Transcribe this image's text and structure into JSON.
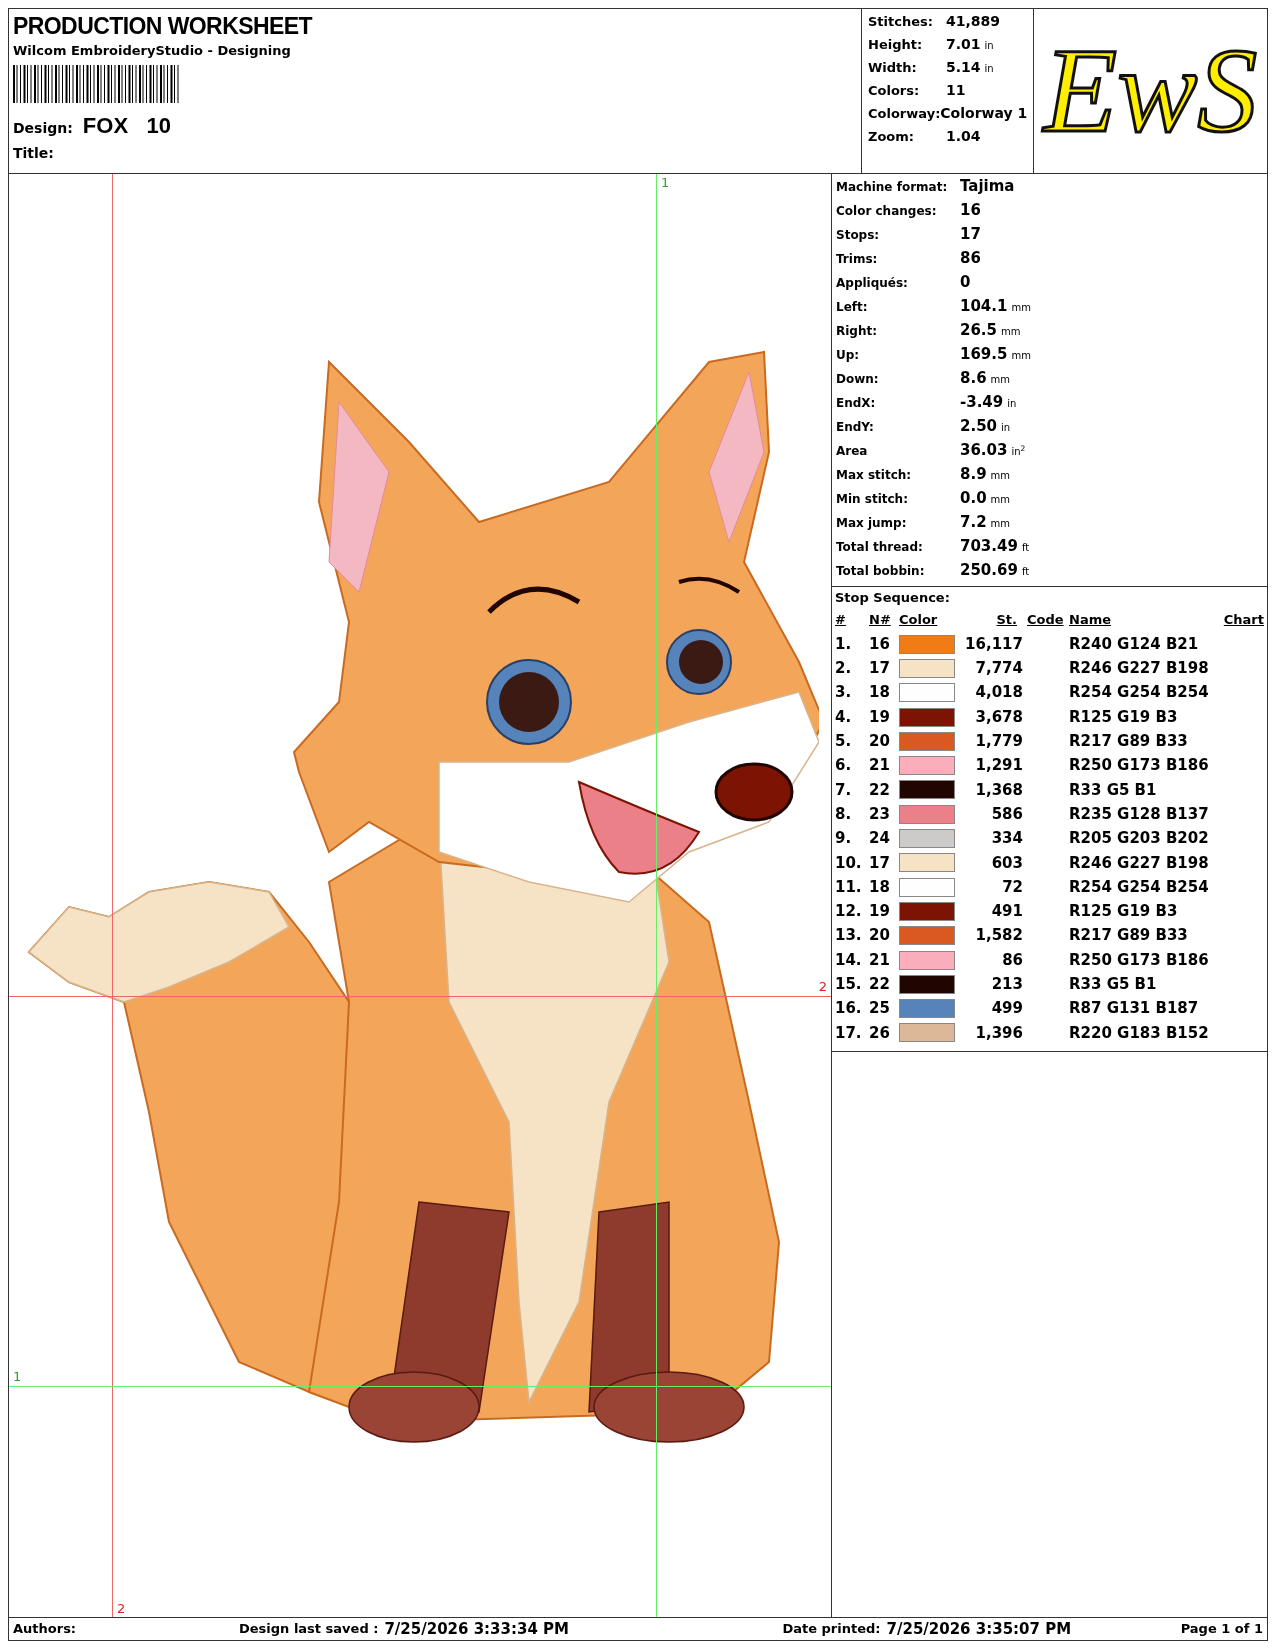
{
  "header": {
    "title": "PRODUCTION WORKSHEET",
    "subtitle": "Wilcom EmbroideryStudio - Designing",
    "design_label": "Design:",
    "design_value": "FOX   10",
    "title_label": "Title:"
  },
  "summary": [
    {
      "label": "Stitches:",
      "value": "41,889"
    },
    {
      "label": "Height:",
      "value": "7.01",
      "unit": "in"
    },
    {
      "label": "Width:",
      "value": "5.14",
      "unit": "in"
    },
    {
      "label": "Colors:",
      "value": "11"
    },
    {
      "label": "Colorway:",
      "value": "Colorway 1"
    },
    {
      "label": "Zoom:",
      "value": "1.04"
    }
  ],
  "logo": {
    "text": "EwS"
  },
  "guides": [
    {
      "kind": "vertical",
      "label": "1",
      "color": "#66ee66"
    },
    {
      "kind": "vertical",
      "label": "2",
      "color": "#ee6666"
    },
    {
      "kind": "horizontal",
      "label": "2",
      "color": "#ee6666"
    },
    {
      "kind": "horizontal",
      "label": "1",
      "color": "#66ee66"
    }
  ],
  "details": [
    {
      "label": "Machine format:",
      "value": "Tajima"
    },
    {
      "label": "Color changes:",
      "value": "16"
    },
    {
      "label": "Stops:",
      "value": "17"
    },
    {
      "label": "Trims:",
      "value": "86"
    },
    {
      "label": "Appliqués:",
      "value": "0"
    },
    {
      "label": "Left:",
      "value": "104.1",
      "unit": "mm"
    },
    {
      "label": "Right:",
      "value": "26.5",
      "unit": "mm"
    },
    {
      "label": "Up:",
      "value": "169.5",
      "unit": "mm"
    },
    {
      "label": "Down:",
      "value": "8.6",
      "unit": "mm"
    },
    {
      "label": "EndX:",
      "value": "-3.49",
      "unit": "in"
    },
    {
      "label": "EndY:",
      "value": "2.50",
      "unit": "in"
    },
    {
      "label": "Area",
      "value": "36.03",
      "unit": "in$^{2}$"
    },
    {
      "label": "Max stitch:",
      "value": "8.9",
      "unit": "mm"
    },
    {
      "label": "Min stitch:",
      "value": "0.0",
      "unit": "mm"
    },
    {
      "label": "Max jump:",
      "value": "7.2",
      "unit": "mm"
    },
    {
      "label": "Total thread:",
      "value": "703.49",
      "unit": "ft"
    },
    {
      "label": "Total bobbin:",
      "value": "250.69",
      "unit": "ft"
    }
  ],
  "stop_sequence": {
    "title": "Stop Sequence:",
    "columns": [
      "#",
      "N#",
      "Color",
      "St.",
      "Code",
      "Name",
      "Chart"
    ],
    "rows": [
      {
        "index": "1.",
        "n": "16",
        "color": "#f07c15",
        "stitches": "16,117",
        "name": "R240 G124 B21"
      },
      {
        "index": "2.",
        "n": "17",
        "color": "#f6e3c6",
        "stitches": "7,774",
        "name": "R246 G227 B198"
      },
      {
        "index": "3.",
        "n": "18",
        "color": "#fefefe",
        "stitches": "4,018",
        "name": "R254 G254 B254"
      },
      {
        "index": "4.",
        "n": "19",
        "color": "#7d1303",
        "stitches": "3,678",
        "name": "R125 G19 B3"
      },
      {
        "index": "5.",
        "n": "20",
        "color": "#d95921",
        "stitches": "1,779",
        "name": "R217 G89 B33"
      },
      {
        "index": "6.",
        "n": "21",
        "color": "#faadba",
        "stitches": "1,291",
        "name": "R250 G173 B186"
      },
      {
        "index": "7.",
        "n": "22",
        "color": "#210501",
        "stitches": "1,368",
        "name": "R33 G5 B1"
      },
      {
        "index": "8.",
        "n": "23",
        "color": "#eb8089",
        "stitches": "586",
        "name": "R235 G128 B137"
      },
      {
        "index": "9.",
        "n": "24",
        "color": "#cdcbca",
        "stitches": "334",
        "name": "R205 G203 B202"
      },
      {
        "index": "10.",
        "n": "17",
        "color": "#f6e3c6",
        "stitches": "603",
        "name": "R246 G227 B198"
      },
      {
        "index": "11.",
        "n": "18",
        "color": "#fefefe",
        "stitches": "72",
        "name": "R254 G254 B254"
      },
      {
        "index": "12.",
        "n": "19",
        "color": "#7d1303",
        "stitches": "491",
        "name": "R125 G19 B3"
      },
      {
        "index": "13.",
        "n": "20",
        "color": "#d95921",
        "stitches": "1,582",
        "name": "R217 G89 B33"
      },
      {
        "index": "14.",
        "n": "21",
        "color": "#faadba",
        "stitches": "86",
        "name": "R250 G173 B186"
      },
      {
        "index": "15.",
        "n": "22",
        "color": "#210501",
        "stitches": "213",
        "name": "R33 G5 B1"
      },
      {
        "index": "16.",
        "n": "25",
        "color": "#5783bb",
        "stitches": "499",
        "name": "R87 G131 B187"
      },
      {
        "index": "17.",
        "n": "26",
        "color": "#dcb798",
        "stitches": "1,396",
        "name": "R220 G183 B152"
      }
    ]
  },
  "footer": {
    "authors_label": "Authors:",
    "saved_label": "Design last saved :",
    "saved_value": "7/25/2026 3:33:34 PM",
    "printed_label": "Date printed:",
    "printed_value": "7/25/2026 3:35:07 PM",
    "page": "Page 1 of 1"
  }
}
